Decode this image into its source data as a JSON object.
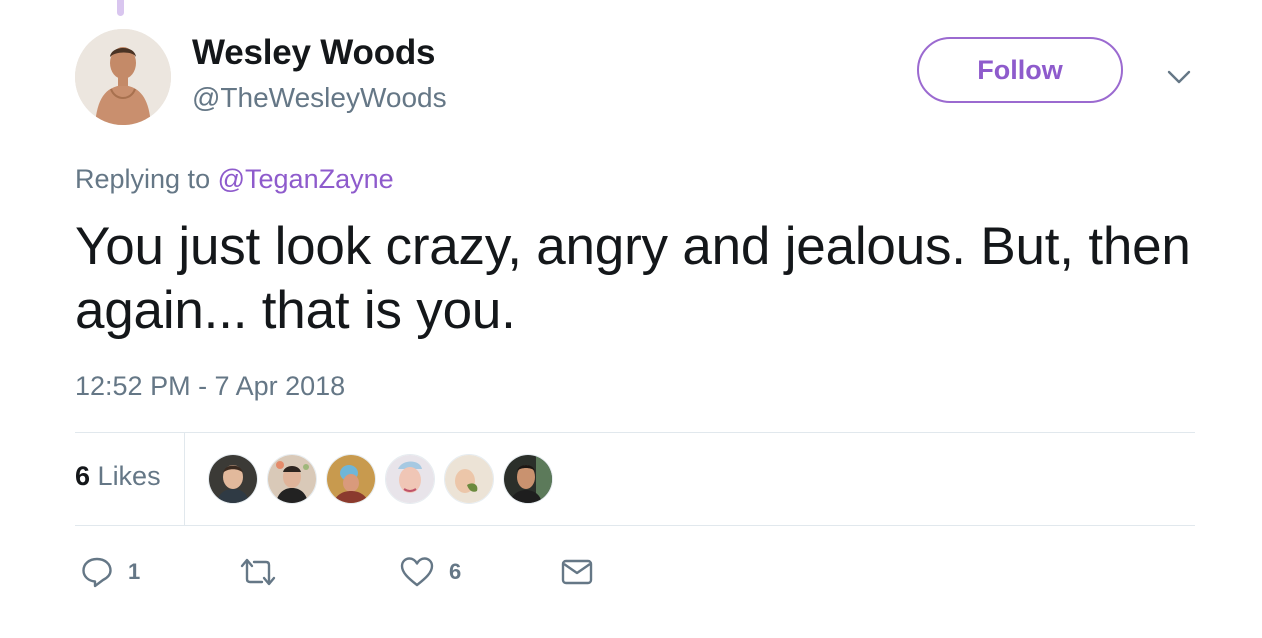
{
  "author": {
    "name": "Wesley Woods",
    "handle": "@TheWesleyWoods"
  },
  "follow_label": "Follow",
  "reply_context": {
    "prefix": "Replying to",
    "mention": "@TeganZayne"
  },
  "tweet_text": "You just look crazy, angry and jealous. But, then again... that is you.",
  "timestamp": "12:52 PM - 7 Apr 2018",
  "stats": {
    "likes_count": "6",
    "likes_label": "Likes"
  },
  "likers": [
    {
      "name": "liker-avatar-1"
    },
    {
      "name": "liker-avatar-2"
    },
    {
      "name": "liker-avatar-3"
    },
    {
      "name": "liker-avatar-4"
    },
    {
      "name": "liker-avatar-5"
    },
    {
      "name": "liker-avatar-6"
    }
  ],
  "actions": {
    "reply_count": "1",
    "retweet_count": "",
    "like_count": "6"
  },
  "colors": {
    "accent": "#8e5bcc",
    "muted": "#657786",
    "text": "#14171a",
    "divider": "#e1e8ed"
  },
  "icons": [
    "chevron-down-icon",
    "reply-icon",
    "retweet-icon",
    "heart-icon",
    "envelope-icon"
  ]
}
